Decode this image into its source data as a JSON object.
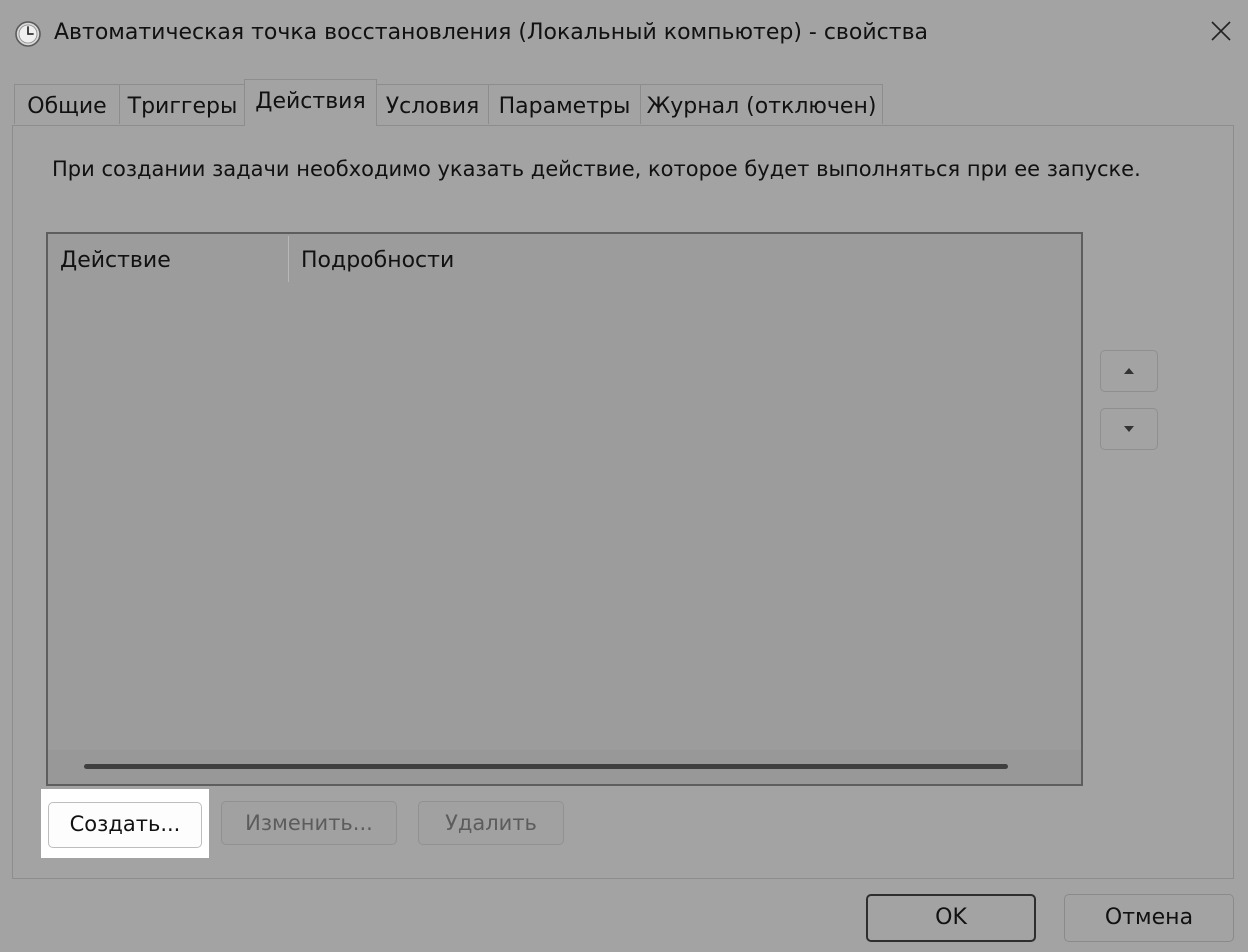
{
  "window": {
    "title": "Автоматическая точка восстановления (Локальный компьютер) - свойства"
  },
  "tabs": [
    {
      "label": "Общие",
      "active": false
    },
    {
      "label": "Триггеры",
      "active": false
    },
    {
      "label": "Действия",
      "active": true
    },
    {
      "label": "Условия",
      "active": false
    },
    {
      "label": "Параметры",
      "active": false
    },
    {
      "label": "Журнал (отключен)",
      "active": false
    }
  ],
  "actions_tab": {
    "description": "При создании задачи необходимо указать действие, которое будет выполняться при ее запуске.",
    "columns": [
      "Действие",
      "Подробности"
    ],
    "rows": [],
    "buttons": {
      "create": "Создать...",
      "edit": "Изменить...",
      "delete": "Удалить"
    }
  },
  "dialog_buttons": {
    "ok": "OK",
    "cancel": "Отмена"
  }
}
